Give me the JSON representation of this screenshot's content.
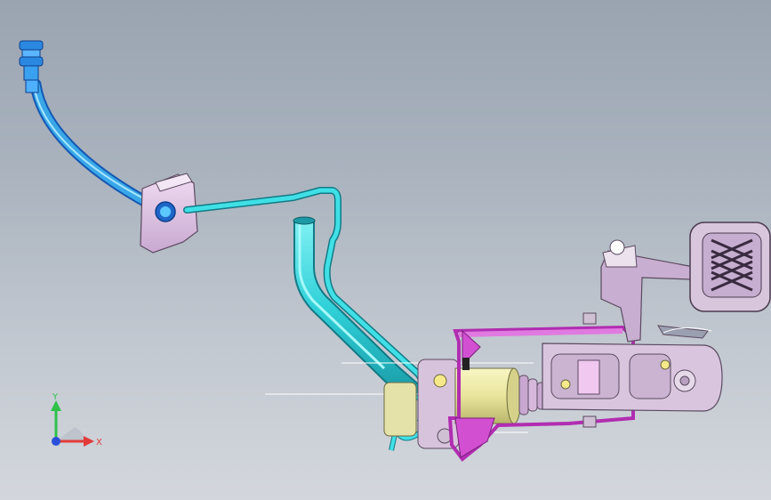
{
  "viewport": {
    "background_top": "#9aa4b1",
    "background_bottom": "#d3d7dd"
  },
  "model": {
    "hose_color": "#3aa8e8",
    "pipe_color": "#3fd4dc",
    "bracket_color": "#d9b7e0",
    "housing_color": "#d24fd2",
    "cylinder_color": "#e8e6a0",
    "pedal_color": "#d4c0d8"
  },
  "triad": {
    "x_label": "X",
    "y_label": "Y",
    "x_color": "#e23a3a",
    "y_color": "#2ec24a",
    "z_color": "#2b4fd8"
  }
}
